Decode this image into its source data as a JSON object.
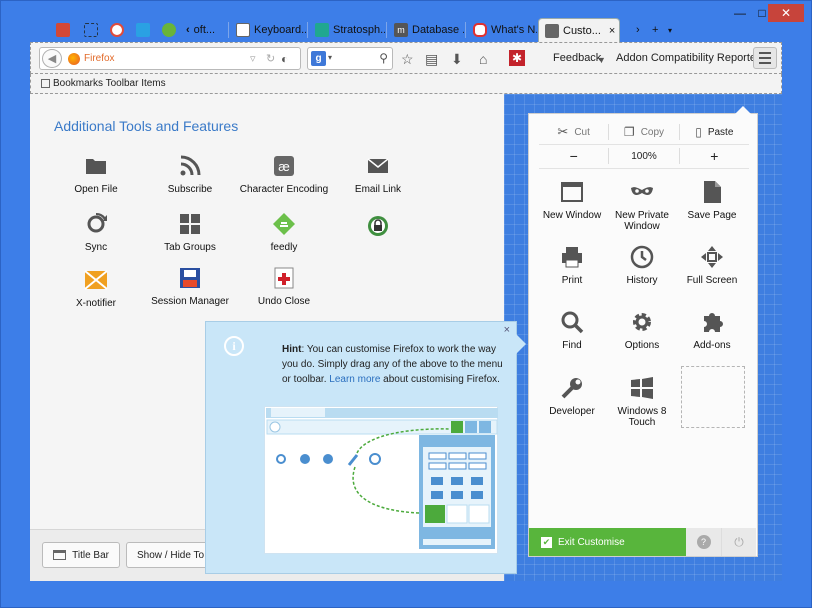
{
  "browser": {
    "tabs": [
      {
        "label": "",
        "favicon_color": "#d34836",
        "icon": "gmail-icon"
      },
      {
        "label": "",
        "favicon_color": "#6b84d6",
        "icon": "dashed-square-icon"
      },
      {
        "label": "",
        "favicon_color": "#e04b3b",
        "icon": "opera-icon"
      },
      {
        "label": "",
        "favicon_color": "#2aa1e3",
        "icon": "bird-icon"
      },
      {
        "label": "",
        "favicon_color": "#69b43a",
        "icon": "feedly-icon"
      },
      {
        "label": "oft...",
        "favicon_color": "#222222",
        "icon": "chevron-left-icon"
      },
      {
        "label": "Keyboard...",
        "favicon_color": "#6a6a6a",
        "icon": "camera-icon"
      },
      {
        "label": "Stratosph...",
        "favicon_color": "#20a890",
        "icon": "stratos-icon"
      },
      {
        "label": "Database ...",
        "favicon_color": "#555555",
        "icon": "m-icon"
      },
      {
        "label": "What's N...",
        "favicon_color": "#e03030",
        "icon": "oracle-icon"
      },
      {
        "label": "Custo...",
        "favicon_color": "#555555",
        "icon": "customize-icon",
        "active": true
      }
    ],
    "window_controls": {
      "minimize": "—",
      "maximize": "□",
      "close": "✕"
    }
  },
  "navbar": {
    "url_text": "Firefox",
    "search_engine_letter": "g",
    "feedback_label": "Feedback",
    "addon_label": "Addon Compatibility Reporter"
  },
  "bookmarks": {
    "label": "Bookmarks Toolbar Items"
  },
  "palette": {
    "title": "Additional Tools and Features",
    "items": [
      {
        "label": "Open File",
        "icon": "folder-icon"
      },
      {
        "label": "Subscribe",
        "icon": "rss-icon"
      },
      {
        "label": "Character Encoding",
        "icon": "character-encoding-icon"
      },
      {
        "label": "Email Link",
        "icon": "email-icon"
      },
      {
        "label": "Sync",
        "icon": "sync-icon"
      },
      {
        "label": "Tab Groups",
        "icon": "tab-groups-icon"
      },
      {
        "label": "feedly",
        "icon": "feedly-icon"
      },
      {
        "label": "",
        "icon": "shield-lock-icon"
      },
      {
        "label": "X-notifier",
        "icon": "x-notifier-icon"
      },
      {
        "label": "Session Manager",
        "icon": "session-manager-icon"
      },
      {
        "label": "Undo Close",
        "icon": "undo-close-icon"
      }
    ]
  },
  "bottom_bar": {
    "title_bar_label": "Title Bar",
    "show_hide_label": "Show / Hide To"
  },
  "menu_panel": {
    "cut_label": "Cut",
    "copy_label": "Copy",
    "paste_label": "Paste",
    "zoom_out": "−",
    "zoom_level": "100%",
    "zoom_in": "+",
    "items": [
      {
        "label": "New Window",
        "icon": "new-window-icon"
      },
      {
        "label": "New Private Window",
        "icon": "private-mask-icon"
      },
      {
        "label": "Save Page",
        "icon": "save-page-icon"
      },
      {
        "label": "Print",
        "icon": "print-icon"
      },
      {
        "label": "History",
        "icon": "history-clock-icon"
      },
      {
        "label": "Full Screen",
        "icon": "fullscreen-icon"
      },
      {
        "label": "Find",
        "icon": "find-icon"
      },
      {
        "label": "Options",
        "icon": "options-gear-icon"
      },
      {
        "label": "Add-ons",
        "icon": "addons-puzzle-icon"
      },
      {
        "label": "Developer",
        "icon": "developer-wrench-icon"
      },
      {
        "label": "Windows 8 Touch",
        "icon": "windows8-icon"
      }
    ],
    "exit_label": "Exit Customise",
    "help": "?",
    "quit": "⏻"
  },
  "hint": {
    "heading": "Hint",
    "text_before_link": ": You can customise Firefox to work the way you do. Simply drag any of the above to the menu or toolbar. ",
    "link_text": "Learn more",
    "text_after_link": " about customising Firefox.",
    "close": "×"
  },
  "colors": {
    "window_blue": "#3d7ee8",
    "exit_green": "#58b53c",
    "hint_blue": "#c9e6f8",
    "title_blue": "#3a7ac8"
  }
}
